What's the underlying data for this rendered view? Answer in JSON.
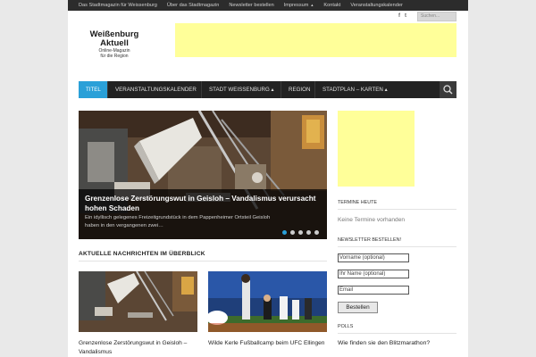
{
  "topnav": [
    {
      "label": "Das Stadtmagazin für Weissenburg",
      "caret": ""
    },
    {
      "label": "Über das Stadtmagazin",
      "caret": ""
    },
    {
      "label": "Newsletter bestellen",
      "caret": ""
    },
    {
      "label": "Impressum",
      "caret": "▲"
    },
    {
      "label": "Kontakt",
      "caret": ""
    },
    {
      "label": "Veranstaltungskalender",
      "caret": ""
    }
  ],
  "social": {
    "facebook": "f",
    "twitter": "t"
  },
  "search": {
    "placeholder": "Suchen..."
  },
  "logo": {
    "line1": "Weißenburg",
    "line2": "Aktuell",
    "line3": "Online-Magazin",
    "line4": "für die Region"
  },
  "mainnav": [
    {
      "label": "TITEL"
    },
    {
      "label": "VERANSTALTUNGSKALENDER"
    },
    {
      "label": "STADT WEISSENBURG ▴"
    },
    {
      "label": "REGION"
    },
    {
      "label": "STADTPLAN – KARTEN ▴"
    }
  ],
  "slider": {
    "title": "Grenzenlose Zerstörungswut in Geisloh – Vandalismus verursacht hohen Schaden",
    "excerpt": "Ein idyllisch gelegenes Freizeitgrundstück in dem Pappenheimer Ortsteil Geisloh haben in den vergangenen zwei…",
    "slide_count": 5,
    "active_slide": 1
  },
  "section": {
    "title": "AKTUELLE NACHRICHTEN IM ÜBERBLICK"
  },
  "news": [
    {
      "title": "Grenzenlose Zerstörungswut in Geisloh – Vandalismus"
    },
    {
      "title": "Wilde Kerle Fußballcamp beim UFC Ellingen"
    }
  ],
  "sidebar": {
    "termine_heading": "TERMINE HEUTE",
    "termine_text": "Keine Termine vorhanden",
    "newsletter_heading": "NEWSLETTER BESTELLEN!",
    "fields": [
      "Vorname (optional)",
      "Ihr Name (optional)",
      "Email"
    ],
    "button": "Bestellen",
    "polls_heading": "POLLS",
    "poll_question": "Wie finden sie den Blitzmarathon?"
  },
  "colors": {
    "accent": "#2aa0d8",
    "nav_bg": "#222222",
    "topbar_bg": "#2c2c2c",
    "ad_yellow": "#ffff99"
  }
}
